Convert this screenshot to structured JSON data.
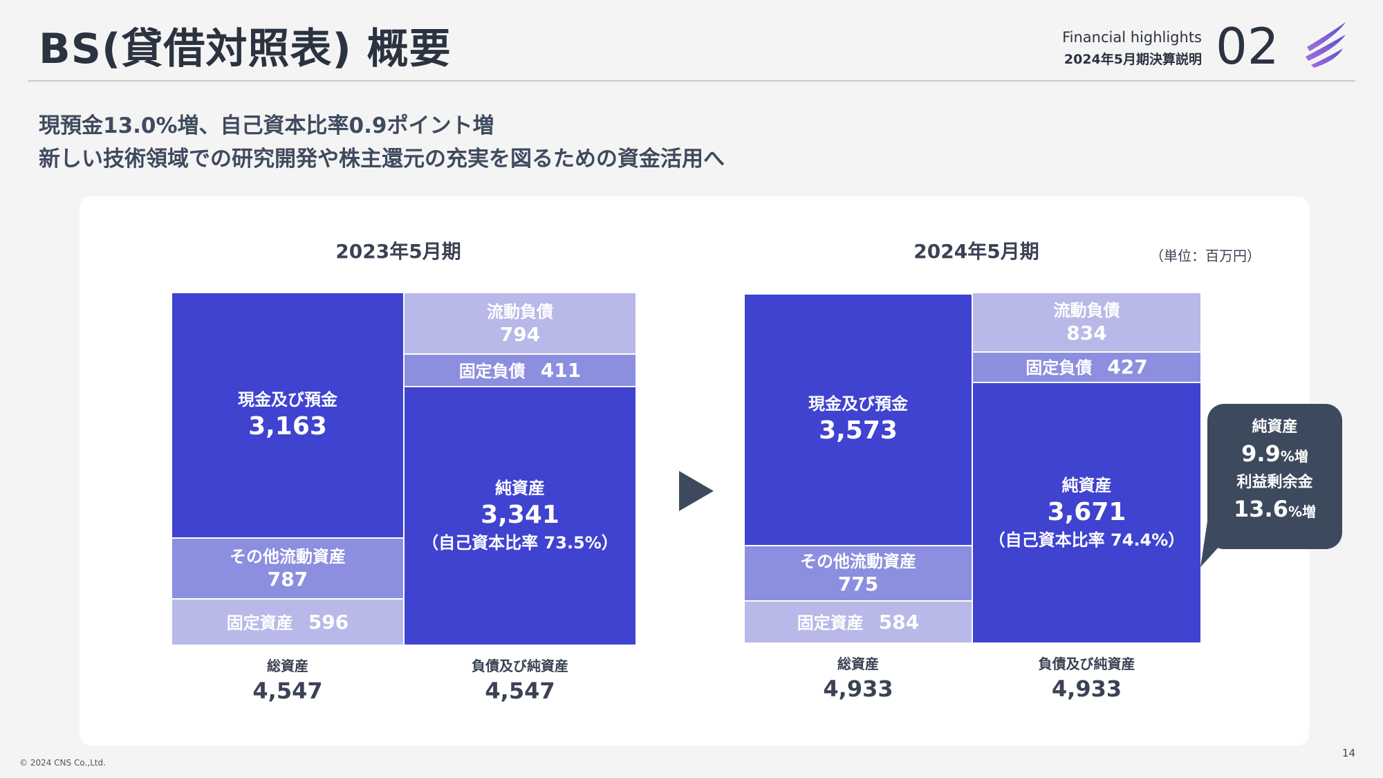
{
  "header": {
    "title": "BS(貸借対照表) 概要",
    "section_en": "Financial highlights",
    "section_jp": "2024年5月期決算説明",
    "section_no": "02"
  },
  "lead": {
    "line1": "現預金13.0%増、自己資本比率0.9ポイント増",
    "line2": "新しい技術領域での研究開発や株主還元の充実を図るための資金活用へ"
  },
  "colors": {
    "cash": "#3f43d0",
    "other": "#8c8edf",
    "fixed": "#b8b9e8",
    "callout": "#3d4a5e"
  },
  "chart_data": [
    {
      "type": "stacked_bar",
      "title": "2023年5月期",
      "assets": [
        {
          "label": "現金及び預金",
          "value": "3,163"
        },
        {
          "label": "その他流動資産",
          "value": "787"
        },
        {
          "label": "固定資産",
          "value": "596"
        }
      ],
      "liabilities_equity": [
        {
          "label": "流動負債",
          "value": "794"
        },
        {
          "label": "固定負債",
          "value": "411"
        },
        {
          "label": "純資産",
          "value": "3,341",
          "note": "（自己資本比率 73.5%）"
        }
      ],
      "total_assets": {
        "label": "総資産",
        "value": "4,547"
      },
      "total_liab_equity": {
        "label": "負債及び純資産",
        "value": "4,547"
      }
    },
    {
      "type": "stacked_bar",
      "title": "2024年5月期",
      "assets": [
        {
          "label": "現金及び預金",
          "value": "3,573"
        },
        {
          "label": "その他流動資産",
          "value": "775"
        },
        {
          "label": "固定資産",
          "value": "584"
        }
      ],
      "liabilities_equity": [
        {
          "label": "流動負債",
          "value": "834"
        },
        {
          "label": "固定負債",
          "value": "427"
        },
        {
          "label": "純資産",
          "value": "3,671",
          "note": "（自己資本比率 74.4%）"
        }
      ],
      "total_assets": {
        "label": "総資産",
        "value": "4,933"
      },
      "total_liab_equity": {
        "label": "負債及び純資産",
        "value": "4,933"
      }
    }
  ],
  "unit": "（単位：百万円）",
  "callout": {
    "label1": "純資産",
    "value1": "9.9",
    "suffix1": "%増",
    "label2": "利益剰余金",
    "value2": "13.6",
    "suffix2": "%増"
  },
  "footer": {
    "copyright": "© 2024 CNS Co.,Ltd.",
    "page": "14"
  }
}
